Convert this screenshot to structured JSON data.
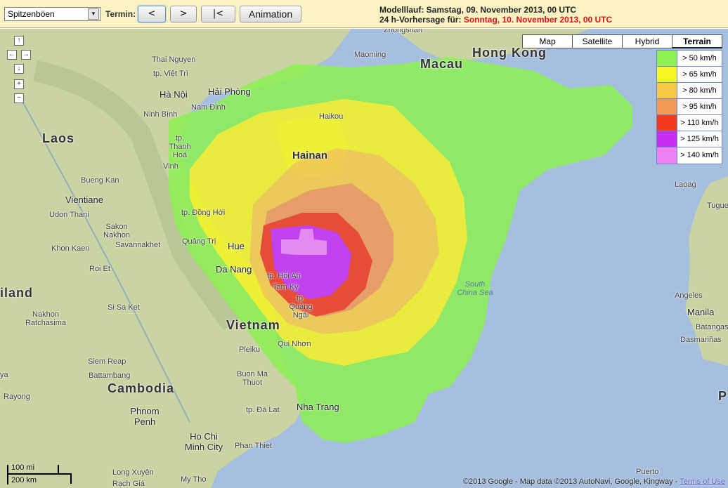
{
  "toolbar": {
    "parameter_selected": "Spitzenböen",
    "termin_label": "Termin:",
    "prev_label": "<",
    "next_label": ">",
    "first_label": "|<",
    "animation_label": "Animation",
    "run_label": "Modelllauf: Samstag, 09. November 2013, 00 UTC",
    "forecast_prefix": "24 h-Vorhersage für: ",
    "forecast_date": "Sonntag, 10. November 2013, 00 UTC"
  },
  "map_types": [
    "Map",
    "Satellite",
    "Hybrid",
    "Terrain"
  ],
  "map_type_active": "Terrain",
  "legend": [
    {
      "label": "> 50 km/h",
      "color": "#8df053"
    },
    {
      "label": "> 65 km/h",
      "color": "#f5f522"
    },
    {
      "label": "> 80 km/h",
      "color": "#f9cb45"
    },
    {
      "label": "> 95 km/h",
      "color": "#f39a55"
    },
    {
      "label": "> 110 km/h",
      "color": "#f13a1b"
    },
    {
      "label": "> 125 km/h",
      "color": "#c62ef2"
    },
    {
      "label": "> 140 km/h",
      "color": "#ee82f4"
    }
  ],
  "places": {
    "hong_kong": "Hong Kong",
    "macau": "Macau",
    "zhongshan": "Zhongshan",
    "maoming": "Maoming",
    "thai_nguyen": "Thai Nguyen",
    "viet_tri": "tp. Việt Trì",
    "ha_noi": "Hà Nội",
    "hai_phong": "Hải Phòng",
    "nam_dinh": "Nam Định",
    "ninh_binh": "Ninh Bình",
    "haikou": "Haikou",
    "hainan": "Hainan",
    "laos": "Laos",
    "thanh_hoa": "tp. Thanh Hoá",
    "vinh": "Vinh",
    "bueng_kan": "Bueng Kan",
    "vientiane": "Vientiane",
    "udon_thani": "Udon Thani",
    "dong_hoi": "tp. Đồng Hới",
    "sakon_nakhon": "Sakon Nakhon",
    "savannakhet": "Savannakhet",
    "khon_kaen": "Khon Kaen",
    "quang_tri": "Quảng Trị",
    "hue": "Hue",
    "da_nang": "Da Nang",
    "roi_et": "Roi Et",
    "hoi_an": "tp. Hội An",
    "tam_ky": "Tam Kỳ",
    "quang_ngai": "tp. Quảng Ngãi",
    "thailand": "iland",
    "si_sa_ket": "Si Sa Ket",
    "nakhon_ratchasima": "Nakhon Ratchasima",
    "vietnam": "Vietnam",
    "pleiku": "Pleiku",
    "qui_nhon": "Qui Nhơn",
    "siem_reap": "Siem Reap",
    "battambang": "Battambang",
    "buon_ma_thuot": "Buon Ma Thuot",
    "cambodia": "Cambodia",
    "rayong": "Rayong",
    "ya": "ya",
    "da_lat": "tp. Đà Lạt",
    "nha_trang": "Nha Trang",
    "phnom_penh": "Phnom Penh",
    "ho_chi_minh": "Ho Chi Minh City",
    "phan_thiet": "Phan Thiet",
    "long_xuyen": "Long Xuyên",
    "my_tho": "My Tho",
    "rach_gia": "Rạch Giá",
    "south_china_sea": "South China Sea",
    "laoag": "Laoag",
    "tugue": "Tugue",
    "angeles": "Angeles",
    "manila": "Manila",
    "batangas": "Batangas",
    "dasmarinas": "Dasmariñas",
    "puerto": "Puerto",
    "p_edge": "P"
  },
  "scale": {
    "miles": "100 mi",
    "km": "200 km"
  },
  "copyright_text": "©2013 Google - Map data ©2013 AutoNavi, Google, Kingway - ",
  "terms_label": "Terms of Use",
  "colors": {
    "toolbar_bg": "#fbf3c4",
    "sea": "#a7bfdf",
    "land": "#c9d4a2",
    "forecast_red": "#e0101a"
  }
}
